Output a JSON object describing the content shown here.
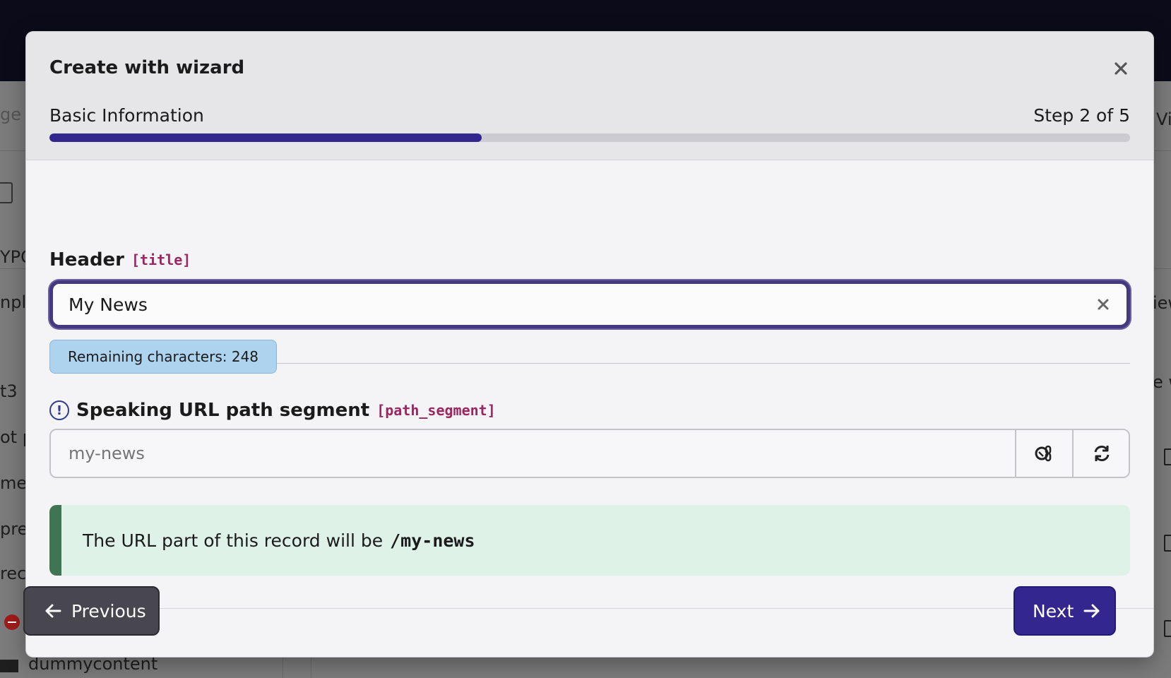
{
  "background": {
    "fragments": [
      "ge t",
      "YPC",
      "nple",
      "t3",
      "ot p",
      "me",
      "pre",
      "rec",
      "Vi",
      "iew",
      "e w"
    ],
    "folder_name": "dummycontent"
  },
  "modal": {
    "title": "Create with wizard",
    "step_label": "Basic Information",
    "step_count": "Step 2 of 5",
    "progress_fraction": 0.4
  },
  "fields": {
    "title": {
      "label": "Header",
      "key": "[title]",
      "value": "My News",
      "remaining": "Remaining characters: 248"
    },
    "slug": {
      "label": "Speaking URL path segment",
      "key": "[path_segment]",
      "placeholder": "my-news",
      "info_icon": "!"
    }
  },
  "info_box": {
    "text": "The URL part of this record will be",
    "path": "/my-news"
  },
  "footer": {
    "previous_label": "Previous",
    "next_label": "Next"
  },
  "colors": {
    "primary": "#33268f",
    "secondary": "#48464f",
    "success_border": "#3f7553",
    "success_bg": "#dff2e7",
    "badge_bg": "#aed3ee",
    "key_accent": "#9c2760"
  },
  "icons": {
    "close": "close-icon",
    "clear": "clear-icon",
    "toggle_slug": "link-toggle-icon",
    "recalculate": "refresh-icon",
    "previous": "arrow-left-icon",
    "next": "arrow-right-icon"
  }
}
